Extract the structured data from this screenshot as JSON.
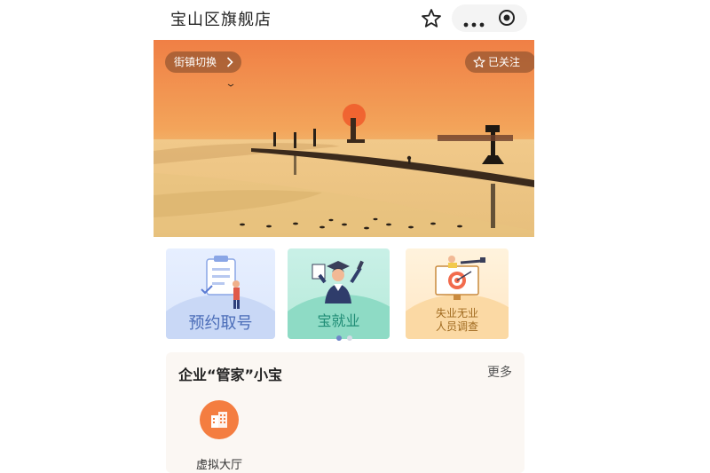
{
  "header": {
    "title": "宝山区旗舰店",
    "favorite_icon": "star-icon",
    "more_icon": "more-dots-icon",
    "close_icon": "target-circle-icon"
  },
  "banner": {
    "switch_label": "街镇切换",
    "follow_label": "已关注"
  },
  "cards": [
    {
      "label": "预约取号"
    },
    {
      "label": "宝就业"
    },
    {
      "label_line1": "失业无业",
      "label_line2": "人员调查"
    }
  ],
  "carousel": {
    "pages": 2,
    "active_index": 0
  },
  "section": {
    "title": "企业“管家”小宝",
    "more_label": "更多",
    "services": [
      {
        "label": "虚拟大厅",
        "icon": "building-icon"
      }
    ]
  },
  "colors": {
    "accent_orange": "#f47d40",
    "dot_active": "#6f86c8"
  }
}
